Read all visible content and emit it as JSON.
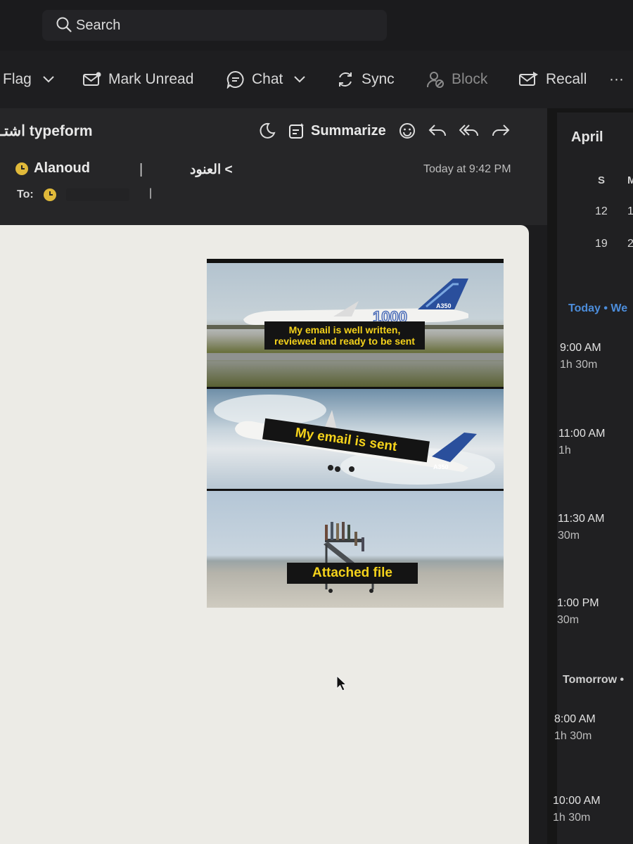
{
  "search": {
    "label": "Search"
  },
  "toolbar": {
    "flag": "Flag",
    "mark_unread": "Mark Unread",
    "chat": "Chat",
    "sync": "Sync",
    "block": "Block",
    "recall": "Recall",
    "more": "···"
  },
  "message": {
    "subject": "اشتـ typeform",
    "summarize": "Summarize",
    "sender": "Alanoud",
    "separator": "|",
    "arabic_name": "العنود <",
    "time": "Today at 9:42 PM",
    "to_label": "To:"
  },
  "meme": {
    "caption_1": "My email is well written, reviewed and ready to be sent",
    "caption_2": "My email is sent",
    "caption_3": "Attached file",
    "plane_mark_1": "1000",
    "plane_mark_2": "A350"
  },
  "calendar": {
    "month": "April",
    "days_of_week": [
      "S",
      "M"
    ],
    "dates": [
      [
        "12",
        "1"
      ],
      [
        "19",
        "2"
      ]
    ],
    "today_label": "Today • We",
    "tomorrow_label": "Tomorrow •",
    "today_events": [
      {
        "time": "9:00 AM",
        "duration": "1h 30m"
      },
      {
        "time": "11:00 AM",
        "duration": "1h"
      },
      {
        "time": "11:30 AM",
        "duration": "30m"
      },
      {
        "time": "1:00 PM",
        "duration": "30m"
      }
    ],
    "tomorrow_events": [
      {
        "time": "8:00 AM",
        "duration": "1h 30m"
      },
      {
        "time": "10:00 AM",
        "duration": "1h 30m"
      }
    ]
  },
  "colors": {
    "accent_blue": "#4c8ddb",
    "status_yellow": "#e0b93a",
    "caption_yellow": "#f4d21b"
  }
}
